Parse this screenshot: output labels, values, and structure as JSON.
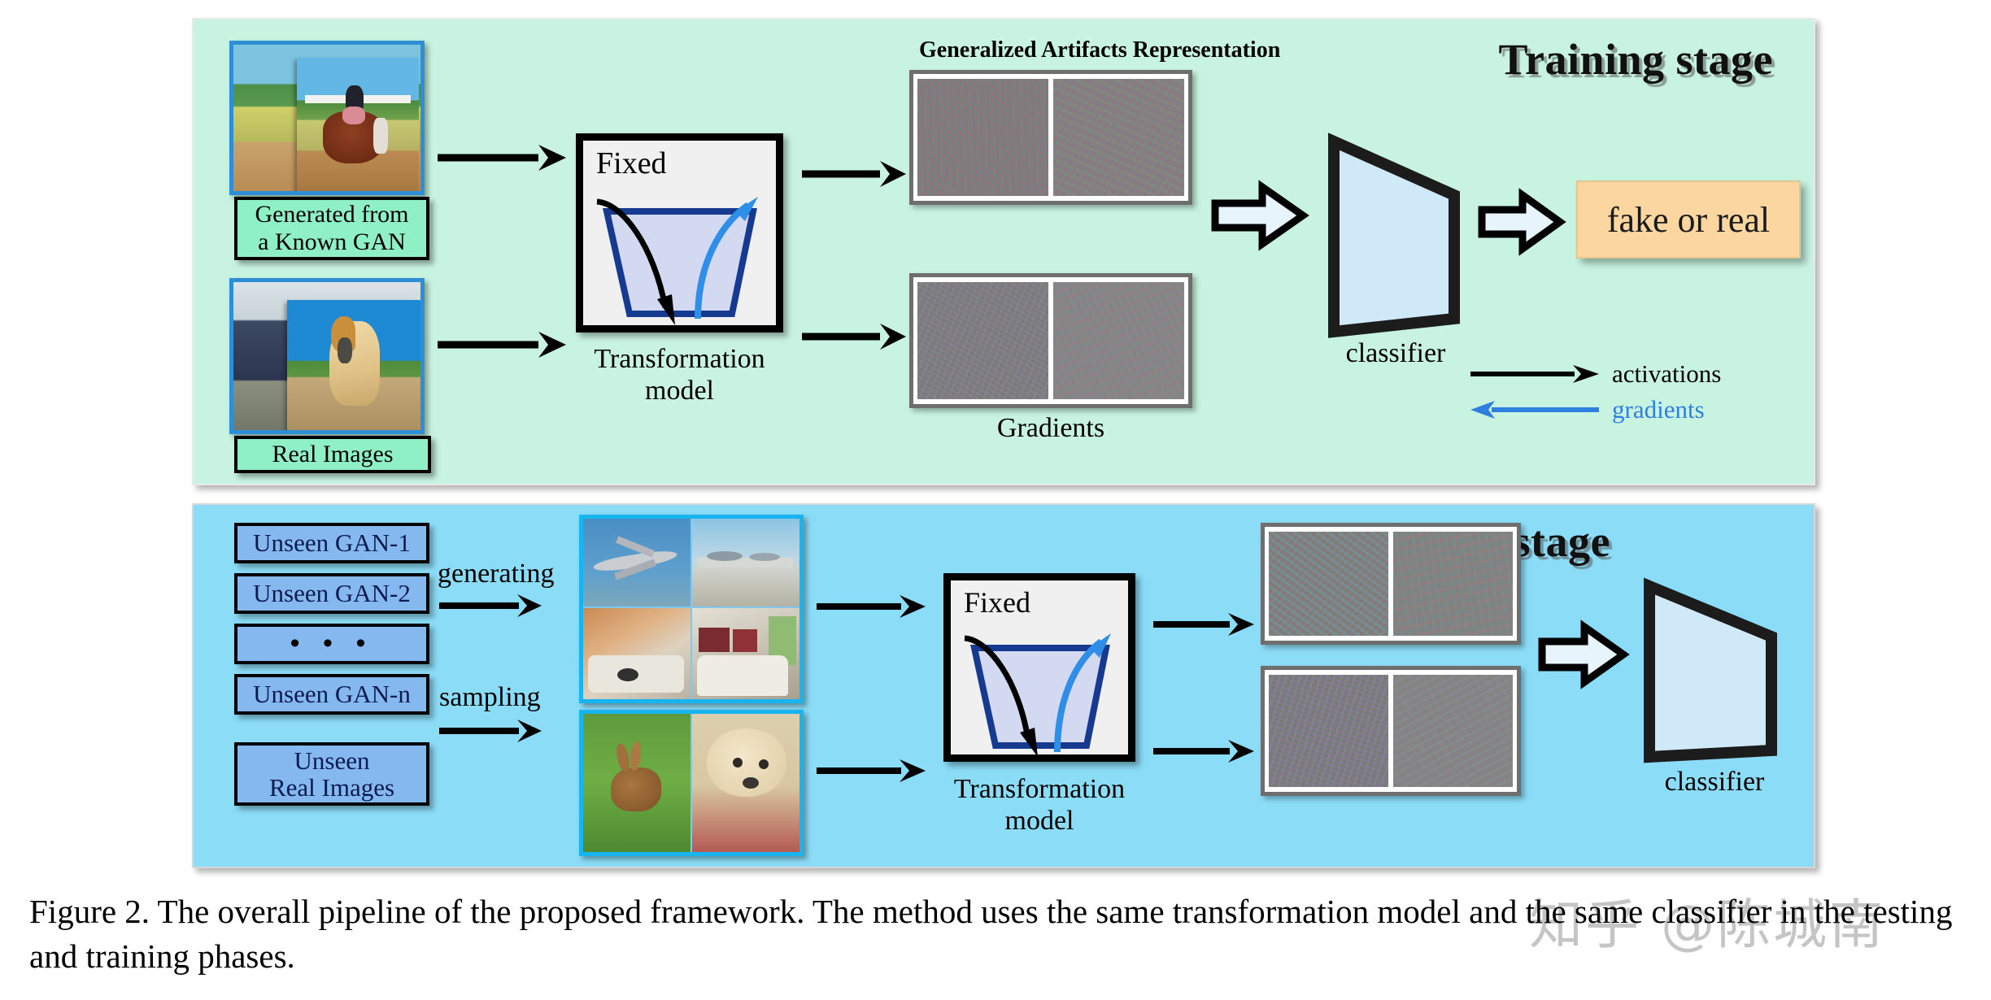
{
  "figure": {
    "caption": "Figure 2. The overall pipeline of the proposed framework. The method uses the same transformation model and the same classifier in the testing and training phases.",
    "watermark": "知乎 @陈城南"
  },
  "colors": {
    "training_panel_bg": "#c8f3e1",
    "test_panel_bg": "#8bdcf7",
    "tag_box_bg": "#8ff0c6",
    "gan_box_bg": "#86b8f0",
    "result_box_bg": "#fbd6a0",
    "classifier_fill": "#cfe9f8",
    "gradient_arrow": "#2f7fe0",
    "activation_arrow": "#000000",
    "thumb_border": "#2f8fd6"
  },
  "training_stage": {
    "title": "Training stage",
    "artifacts_heading": "Generalized Artifacts Representation",
    "inputs": [
      {
        "tag": "Generated from\na Known GAN",
        "photo": "gan-generated-horse-rider"
      },
      {
        "tag": "Real Images",
        "photo": "real-horse"
      }
    ],
    "transformation": {
      "fixed_label": "Fixed",
      "caption": "Transformation\nmodel"
    },
    "representations": [
      {
        "name": "artifacts",
        "label": ""
      },
      {
        "name": "gradients",
        "label": "Gradients"
      }
    ],
    "classifier_label": "classifier",
    "result_label": "fake or real",
    "legend": [
      {
        "arrow": "right-black-arrow",
        "label": "activations",
        "color": "#000000"
      },
      {
        "arrow": "left-blue-arrow",
        "label": "gradients",
        "color": "#2f7fe0"
      }
    ]
  },
  "test_stage": {
    "title": "Test stage",
    "sources": [
      {
        "label": "Unseen GAN-1"
      },
      {
        "label": "Unseen GAN-2"
      },
      {
        "label": "• • •"
      },
      {
        "label": "Unseen GAN-n"
      },
      {
        "label": "Unseen\nReal Images"
      }
    ],
    "flow_labels": [
      {
        "label": "generating"
      },
      {
        "label": "sampling"
      }
    ],
    "image_grids": [
      {
        "name": "generated-images-grid",
        "tiles": [
          "airplane",
          "airport-runway",
          "bedroom-a",
          "bedroom-b"
        ]
      },
      {
        "name": "real-images-grid",
        "tiles": [
          "rabbit",
          "poodle-dog"
        ]
      }
    ],
    "transformation": {
      "fixed_label": "Fixed",
      "caption": "Transformation\nmodel"
    },
    "classifier_label": "classifier"
  }
}
